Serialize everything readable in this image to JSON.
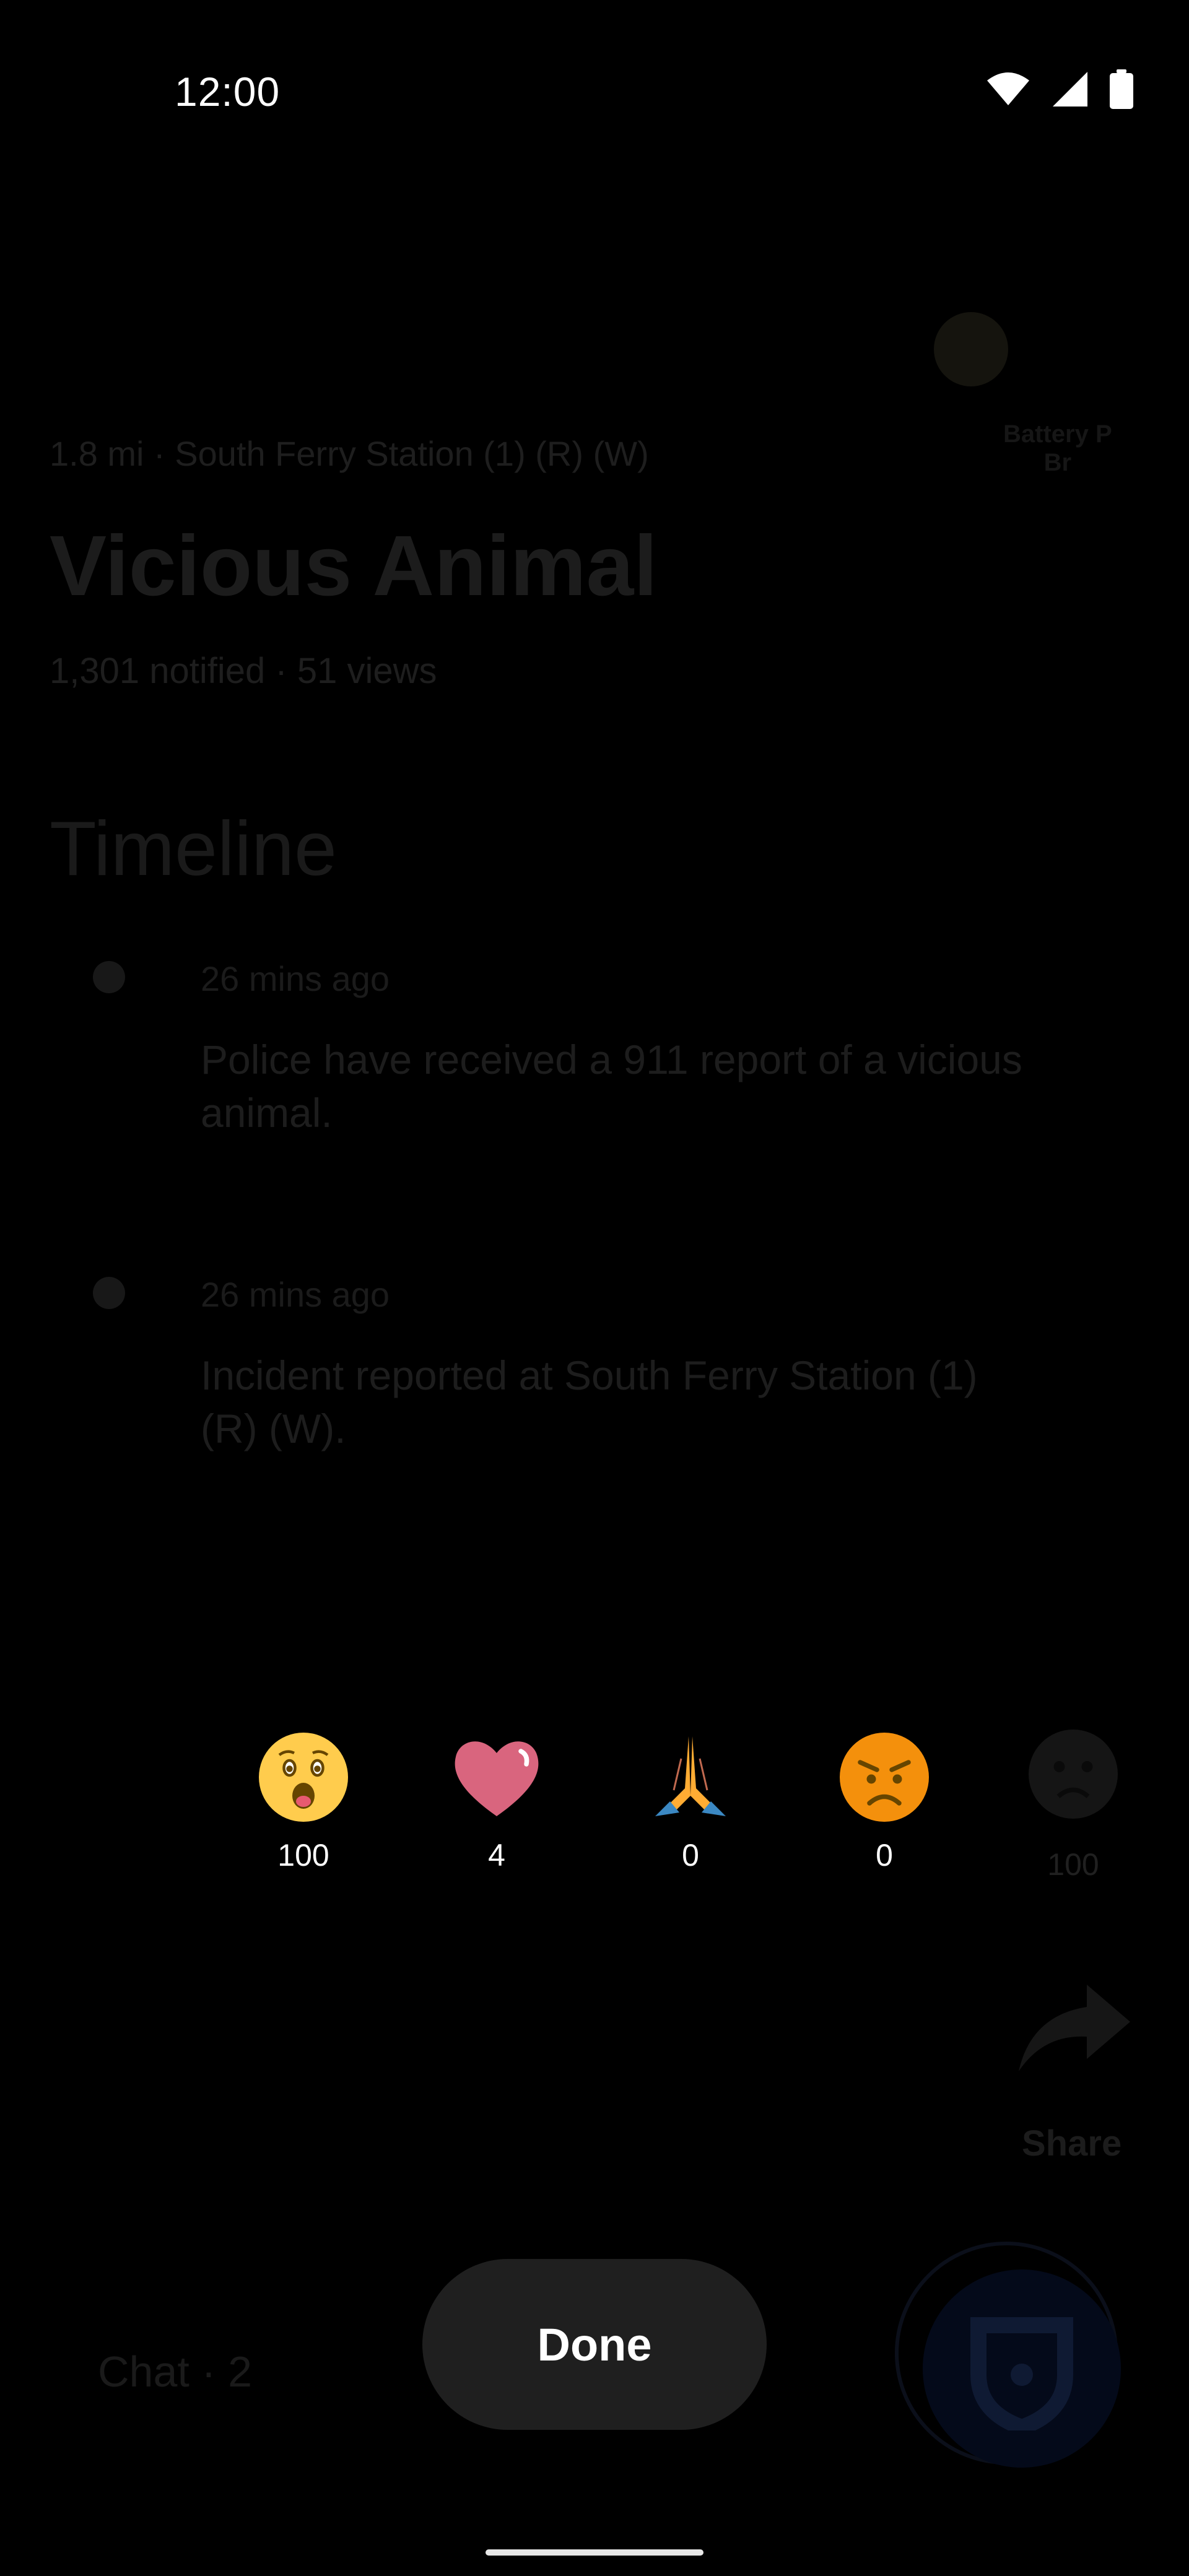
{
  "status_bar": {
    "time": "12:00",
    "icons": [
      "wifi-icon",
      "signal-icon",
      "battery-icon"
    ]
  },
  "incident": {
    "distance_location": "1.8 mi · South Ferry Station (1) (R) (W)",
    "title": "Vicious Animal",
    "stats": "1,301 notified · 51 views",
    "map_label": "Battery P\nBr"
  },
  "timeline": {
    "heading": "Timeline",
    "entries": [
      {
        "time": "26 mins ago",
        "text": "Police have received a 911 report of a vicious animal."
      },
      {
        "time": "26 mins ago",
        "text": "Incident reported at South Ferry Station (1) (R) (W)."
      }
    ]
  },
  "reactions": [
    {
      "icon": "astonished-face-icon",
      "count": "100"
    },
    {
      "icon": "heart-icon",
      "count": "4"
    },
    {
      "icon": "praying-hands-icon",
      "count": "0"
    },
    {
      "icon": "angry-face-icon",
      "count": "0"
    }
  ],
  "background_reaction": {
    "icon": "astonished-face-icon",
    "count": "100"
  },
  "share": {
    "label": "Share"
  },
  "chat": {
    "label": "Chat · 2"
  },
  "done_button": {
    "label": "Done"
  },
  "colors": {
    "emoji_yellow": "#FFCC4D",
    "heart": "#D9657E",
    "angry_orange": "#F4900C",
    "hands_blue": "#55ACEE",
    "button_bg": "#1F1F1F"
  }
}
